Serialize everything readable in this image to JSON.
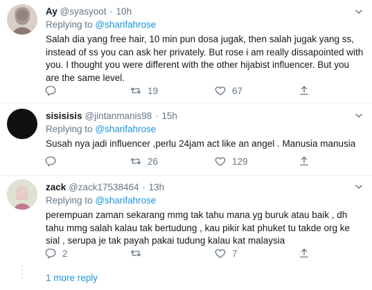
{
  "tweets": [
    {
      "name": "Ay",
      "handle": "@syasyoot",
      "time": "10h",
      "replying_prefix": "Replying to",
      "replying_to": "@sharifahrose",
      "text_lines": [
        "Salah dia yang free hair, 10 min pun dosa jugak, then salah jugak yang ss,",
        "instead of ss you can ask her privately. But rose i am really dissapointed with",
        "you. I thought you were different with the other hijabist influencer. But you",
        "are the same level."
      ],
      "replies": "",
      "retweets": "19",
      "likes": "67"
    },
    {
      "name": "sisisisis",
      "handle": "@jintanmanis98",
      "time": "15h",
      "replying_prefix": "Replying to",
      "replying_to": "@sharifahrose",
      "text_lines": [
        "Susah nya jadi influencer ,perlu 24jam act like an angel . Manusia manusia"
      ],
      "replies": "",
      "retweets": "26",
      "likes": "129"
    },
    {
      "name": "zack",
      "handle": "@zack17538464",
      "time": "13h",
      "replying_prefix": "Replying to",
      "replying_to": "@sharifahrose",
      "text_lines": [
        "perempuan zaman sekarang mmg tak tahu mana yg buruk atau baik , dh",
        "tahu mmg salah kalau tak bertudung , kau pikir kat phuket tu takde org ke",
        "sial , serupa je tak payah pakai tudung kalau kat malaysia"
      ],
      "replies": "2",
      "retweets": "",
      "likes": "7"
    }
  ],
  "more_replies": "1 more reply",
  "colors": {
    "accent": "#1b95e0",
    "muted": "#657786",
    "separator": "#e6ecf0"
  },
  "icons": {
    "reply": "reply-icon",
    "retweet": "retweet-icon",
    "like": "heart-icon",
    "share": "share-icon",
    "caret": "chevron-down-icon"
  }
}
